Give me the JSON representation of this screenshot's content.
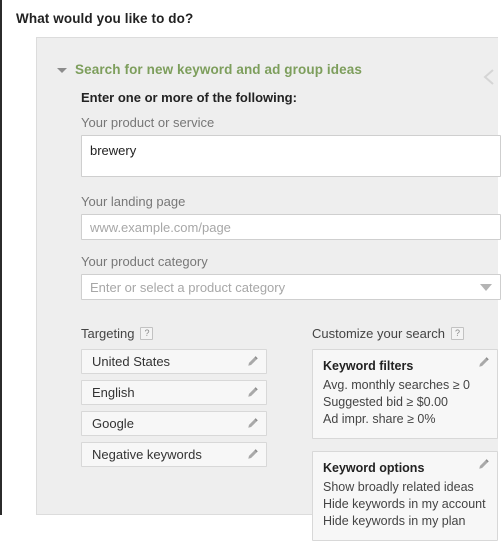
{
  "page_title": "What would you like to do?",
  "colors": {
    "accent_green": "#7d9e5c",
    "panel_bg": "#eeeeee",
    "chip_bg": "#f7f7f7",
    "border": "#d8d8d8"
  },
  "section": {
    "title": "Search for new keyword and ad group ideas",
    "toggle_icon": "triangle-down-icon",
    "collapse_icon": "chevron-left-icon"
  },
  "form": {
    "subhead": "Enter one or more of the following:",
    "product_or_service": {
      "label": "Your product or service",
      "value": "brewery",
      "placeholder": ""
    },
    "landing_page": {
      "label": "Your landing page",
      "value": "",
      "placeholder": "www.example.com/page"
    },
    "product_category": {
      "label": "Your product category",
      "value": "Enter or select a product category",
      "dropdown_icon": "triangle-down-icon"
    }
  },
  "targeting": {
    "heading": "Targeting",
    "help_icon": "question-mark-icon",
    "help_label": "?",
    "items": [
      {
        "label": "United States",
        "edit_icon": "pencil-icon"
      },
      {
        "label": "English",
        "edit_icon": "pencil-icon"
      },
      {
        "label": "Google",
        "edit_icon": "pencil-icon"
      },
      {
        "label": "Negative keywords",
        "edit_icon": "pencil-icon"
      }
    ]
  },
  "customize": {
    "heading": "Customize your search",
    "help_icon": "question-mark-icon",
    "help_label": "?",
    "cards": [
      {
        "title": "Keyword filters",
        "edit_icon": "pencil-icon",
        "lines": [
          "Avg. monthly searches ≥ 0",
          "Suggested bid ≥ $0.00",
          "Ad impr. share ≥ 0%"
        ]
      },
      {
        "title": "Keyword options",
        "edit_icon": "pencil-icon",
        "lines": [
          "Show broadly related ideas",
          "Hide keywords in my account",
          "Hide keywords in my plan"
        ]
      }
    ]
  }
}
